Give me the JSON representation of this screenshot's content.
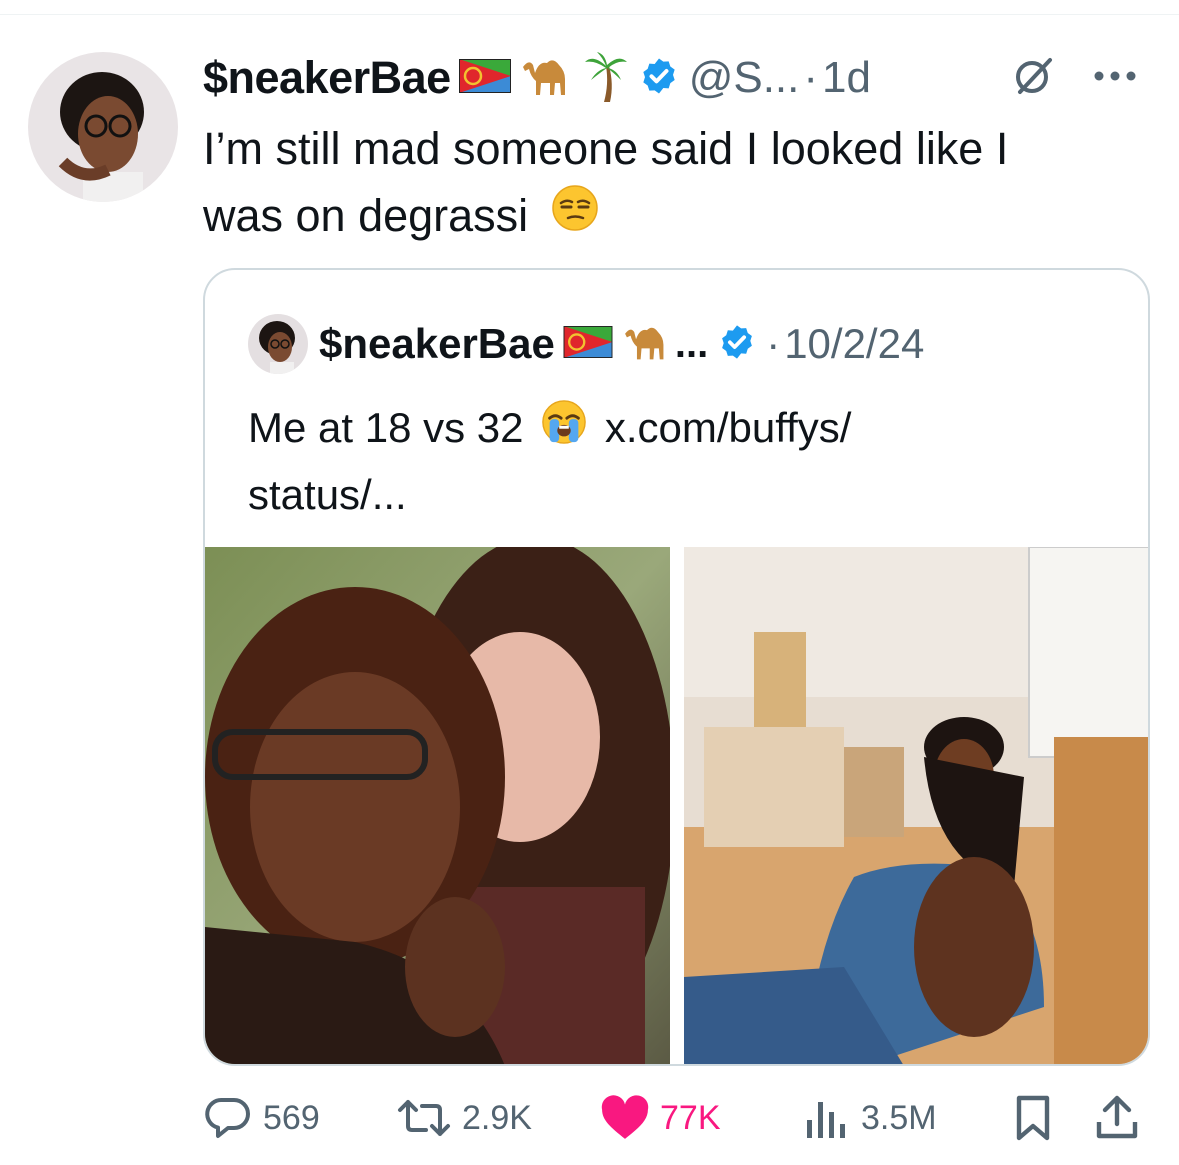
{
  "tweet": {
    "display_name": "$neakerBae",
    "emojis": [
      "eritrea-flag",
      "camel",
      "palm-tree"
    ],
    "handle": "@S...",
    "separator": "·",
    "time": "1d",
    "text_line1": "I’m still mad someone said I looked like I",
    "text_line2": "was on degrassi",
    "text_emoji": "unamused-face"
  },
  "quoted": {
    "display_name": "$neakerBae",
    "truncation": "...",
    "separator": "·",
    "date": "10/2/24",
    "text_part1": "Me at 18 vs 32",
    "text_emoji": "loudly-crying-face",
    "text_part2": "x.com/buffys/",
    "text_line2": "status/..."
  },
  "actions": {
    "replies": "569",
    "reposts": "2.9K",
    "likes": "77K",
    "views": "3.5M"
  },
  "colors": {
    "text": "#0f1419",
    "secondary": "#536471",
    "verified": "#1d9bf0",
    "like": "#f91880",
    "border": "#cfd9de"
  }
}
